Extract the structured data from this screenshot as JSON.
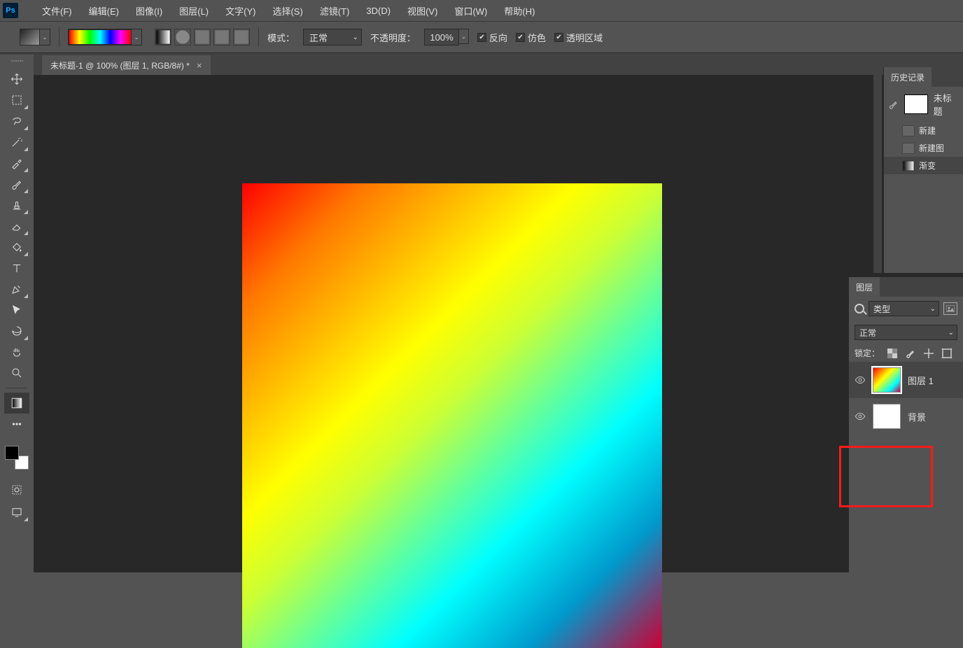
{
  "app": {
    "icon_label": "Ps"
  },
  "menubar": {
    "items": [
      "文件(F)",
      "编辑(E)",
      "图像(I)",
      "图层(L)",
      "文字(Y)",
      "选择(S)",
      "滤镜(T)",
      "3D(D)",
      "视图(V)",
      "窗口(W)",
      "帮助(H)"
    ]
  },
  "options": {
    "mode_label": "模式：",
    "mode_value": "正常",
    "opacity_label": "不透明度：",
    "opacity_value": "100%",
    "reverse_label": "反向",
    "dither_label": "仿色",
    "transparent_label": "透明区域"
  },
  "document": {
    "tab_title": "未标题-1 @ 100% (图层 1, RGB/8#) *"
  },
  "history_panel": {
    "tab": "历史记录",
    "doc_label": "未标题",
    "steps": [
      "新建",
      "新建图",
      "渐变"
    ]
  },
  "layers_panel": {
    "tab": "图层",
    "type_label": "类型",
    "blend_value": "正常",
    "lock_label": "锁定：",
    "layers": [
      {
        "name": "图层 1",
        "selected": true,
        "gradient": true
      },
      {
        "name": "背景",
        "selected": false,
        "gradient": false
      }
    ]
  }
}
